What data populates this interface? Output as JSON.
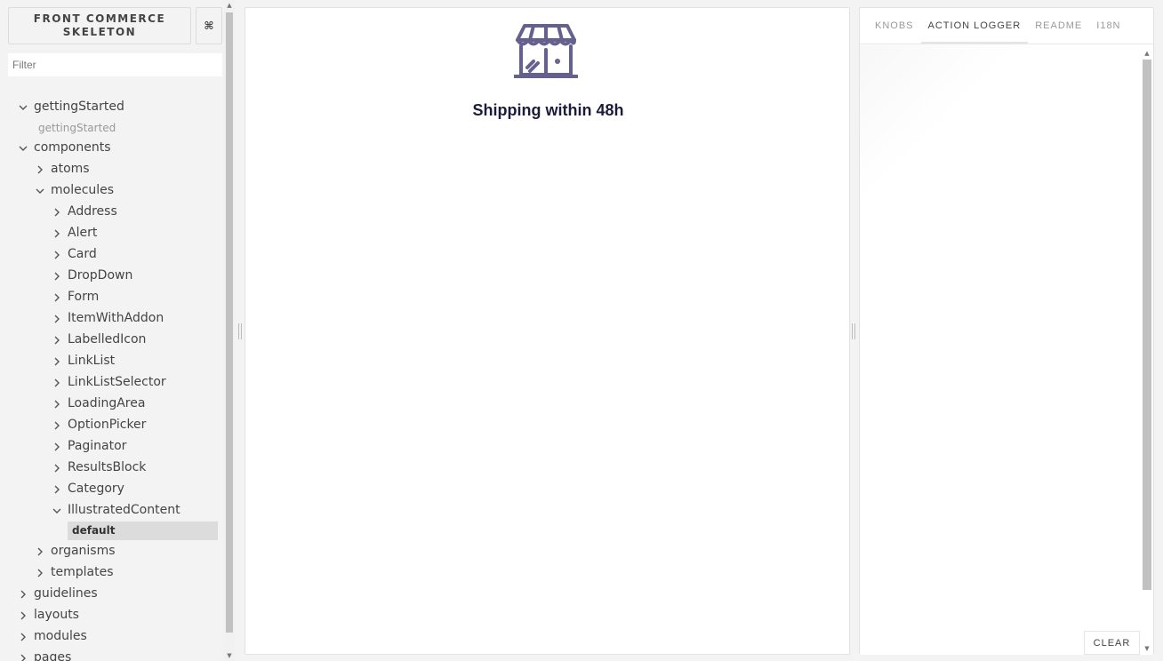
{
  "sidebar": {
    "brand": "FRONT COMMERCE SKELETON",
    "shortcut_label": "⌘",
    "filter_placeholder": "Filter",
    "tree": [
      {
        "label": "gettingStarted",
        "kind": "group",
        "depth": 0,
        "expanded": true
      },
      {
        "label": "gettingStarted",
        "kind": "story",
        "depth": 1
      },
      {
        "label": "components",
        "kind": "group",
        "depth": 0,
        "expanded": true
      },
      {
        "label": "atoms",
        "kind": "folder",
        "depth": 1,
        "expanded": false
      },
      {
        "label": "molecules",
        "kind": "folder",
        "depth": 1,
        "expanded": true
      },
      {
        "label": "Address",
        "kind": "component",
        "depth": 2,
        "expanded": false
      },
      {
        "label": "Alert",
        "kind": "component",
        "depth": 2,
        "expanded": false
      },
      {
        "label": "Card",
        "kind": "component",
        "depth": 2,
        "expanded": false
      },
      {
        "label": "DropDown",
        "kind": "component",
        "depth": 2,
        "expanded": false
      },
      {
        "label": "Form",
        "kind": "component",
        "depth": 2,
        "expanded": false
      },
      {
        "label": "ItemWithAddon",
        "kind": "component",
        "depth": 2,
        "expanded": false
      },
      {
        "label": "LabelledIcon",
        "kind": "component",
        "depth": 2,
        "expanded": false
      },
      {
        "label": "LinkList",
        "kind": "component",
        "depth": 2,
        "expanded": false
      },
      {
        "label": "LinkListSelector",
        "kind": "component",
        "depth": 2,
        "expanded": false
      },
      {
        "label": "LoadingArea",
        "kind": "component",
        "depth": 2,
        "expanded": false
      },
      {
        "label": "OptionPicker",
        "kind": "component",
        "depth": 2,
        "expanded": false
      },
      {
        "label": "Paginator",
        "kind": "component",
        "depth": 2,
        "expanded": false
      },
      {
        "label": "ResultsBlock",
        "kind": "component",
        "depth": 2,
        "expanded": false
      },
      {
        "label": "Category",
        "kind": "component",
        "depth": 2,
        "expanded": false
      },
      {
        "label": "IllustratedContent",
        "kind": "component",
        "depth": 2,
        "expanded": true
      },
      {
        "label": "default",
        "kind": "story",
        "depth": 3,
        "selected": true
      },
      {
        "label": "organisms",
        "kind": "folder",
        "depth": 1,
        "expanded": false
      },
      {
        "label": "templates",
        "kind": "folder",
        "depth": 1,
        "expanded": false
      },
      {
        "label": "guidelines",
        "kind": "group",
        "depth": 0,
        "expanded": false
      },
      {
        "label": "layouts",
        "kind": "group",
        "depth": 0,
        "expanded": false
      },
      {
        "label": "modules",
        "kind": "group",
        "depth": 0,
        "expanded": false
      },
      {
        "label": "pages",
        "kind": "group",
        "depth": 0,
        "expanded": false
      }
    ]
  },
  "preview": {
    "icon": "shop-icon",
    "title": "Shipping within 48h",
    "icon_color": "#65618f"
  },
  "addons": {
    "tabs": [
      {
        "label": "KNOBS",
        "active": false
      },
      {
        "label": "ACTION LOGGER",
        "active": true
      },
      {
        "label": "README",
        "active": false
      },
      {
        "label": "I18N",
        "active": false
      }
    ],
    "clear_label": "CLEAR"
  }
}
